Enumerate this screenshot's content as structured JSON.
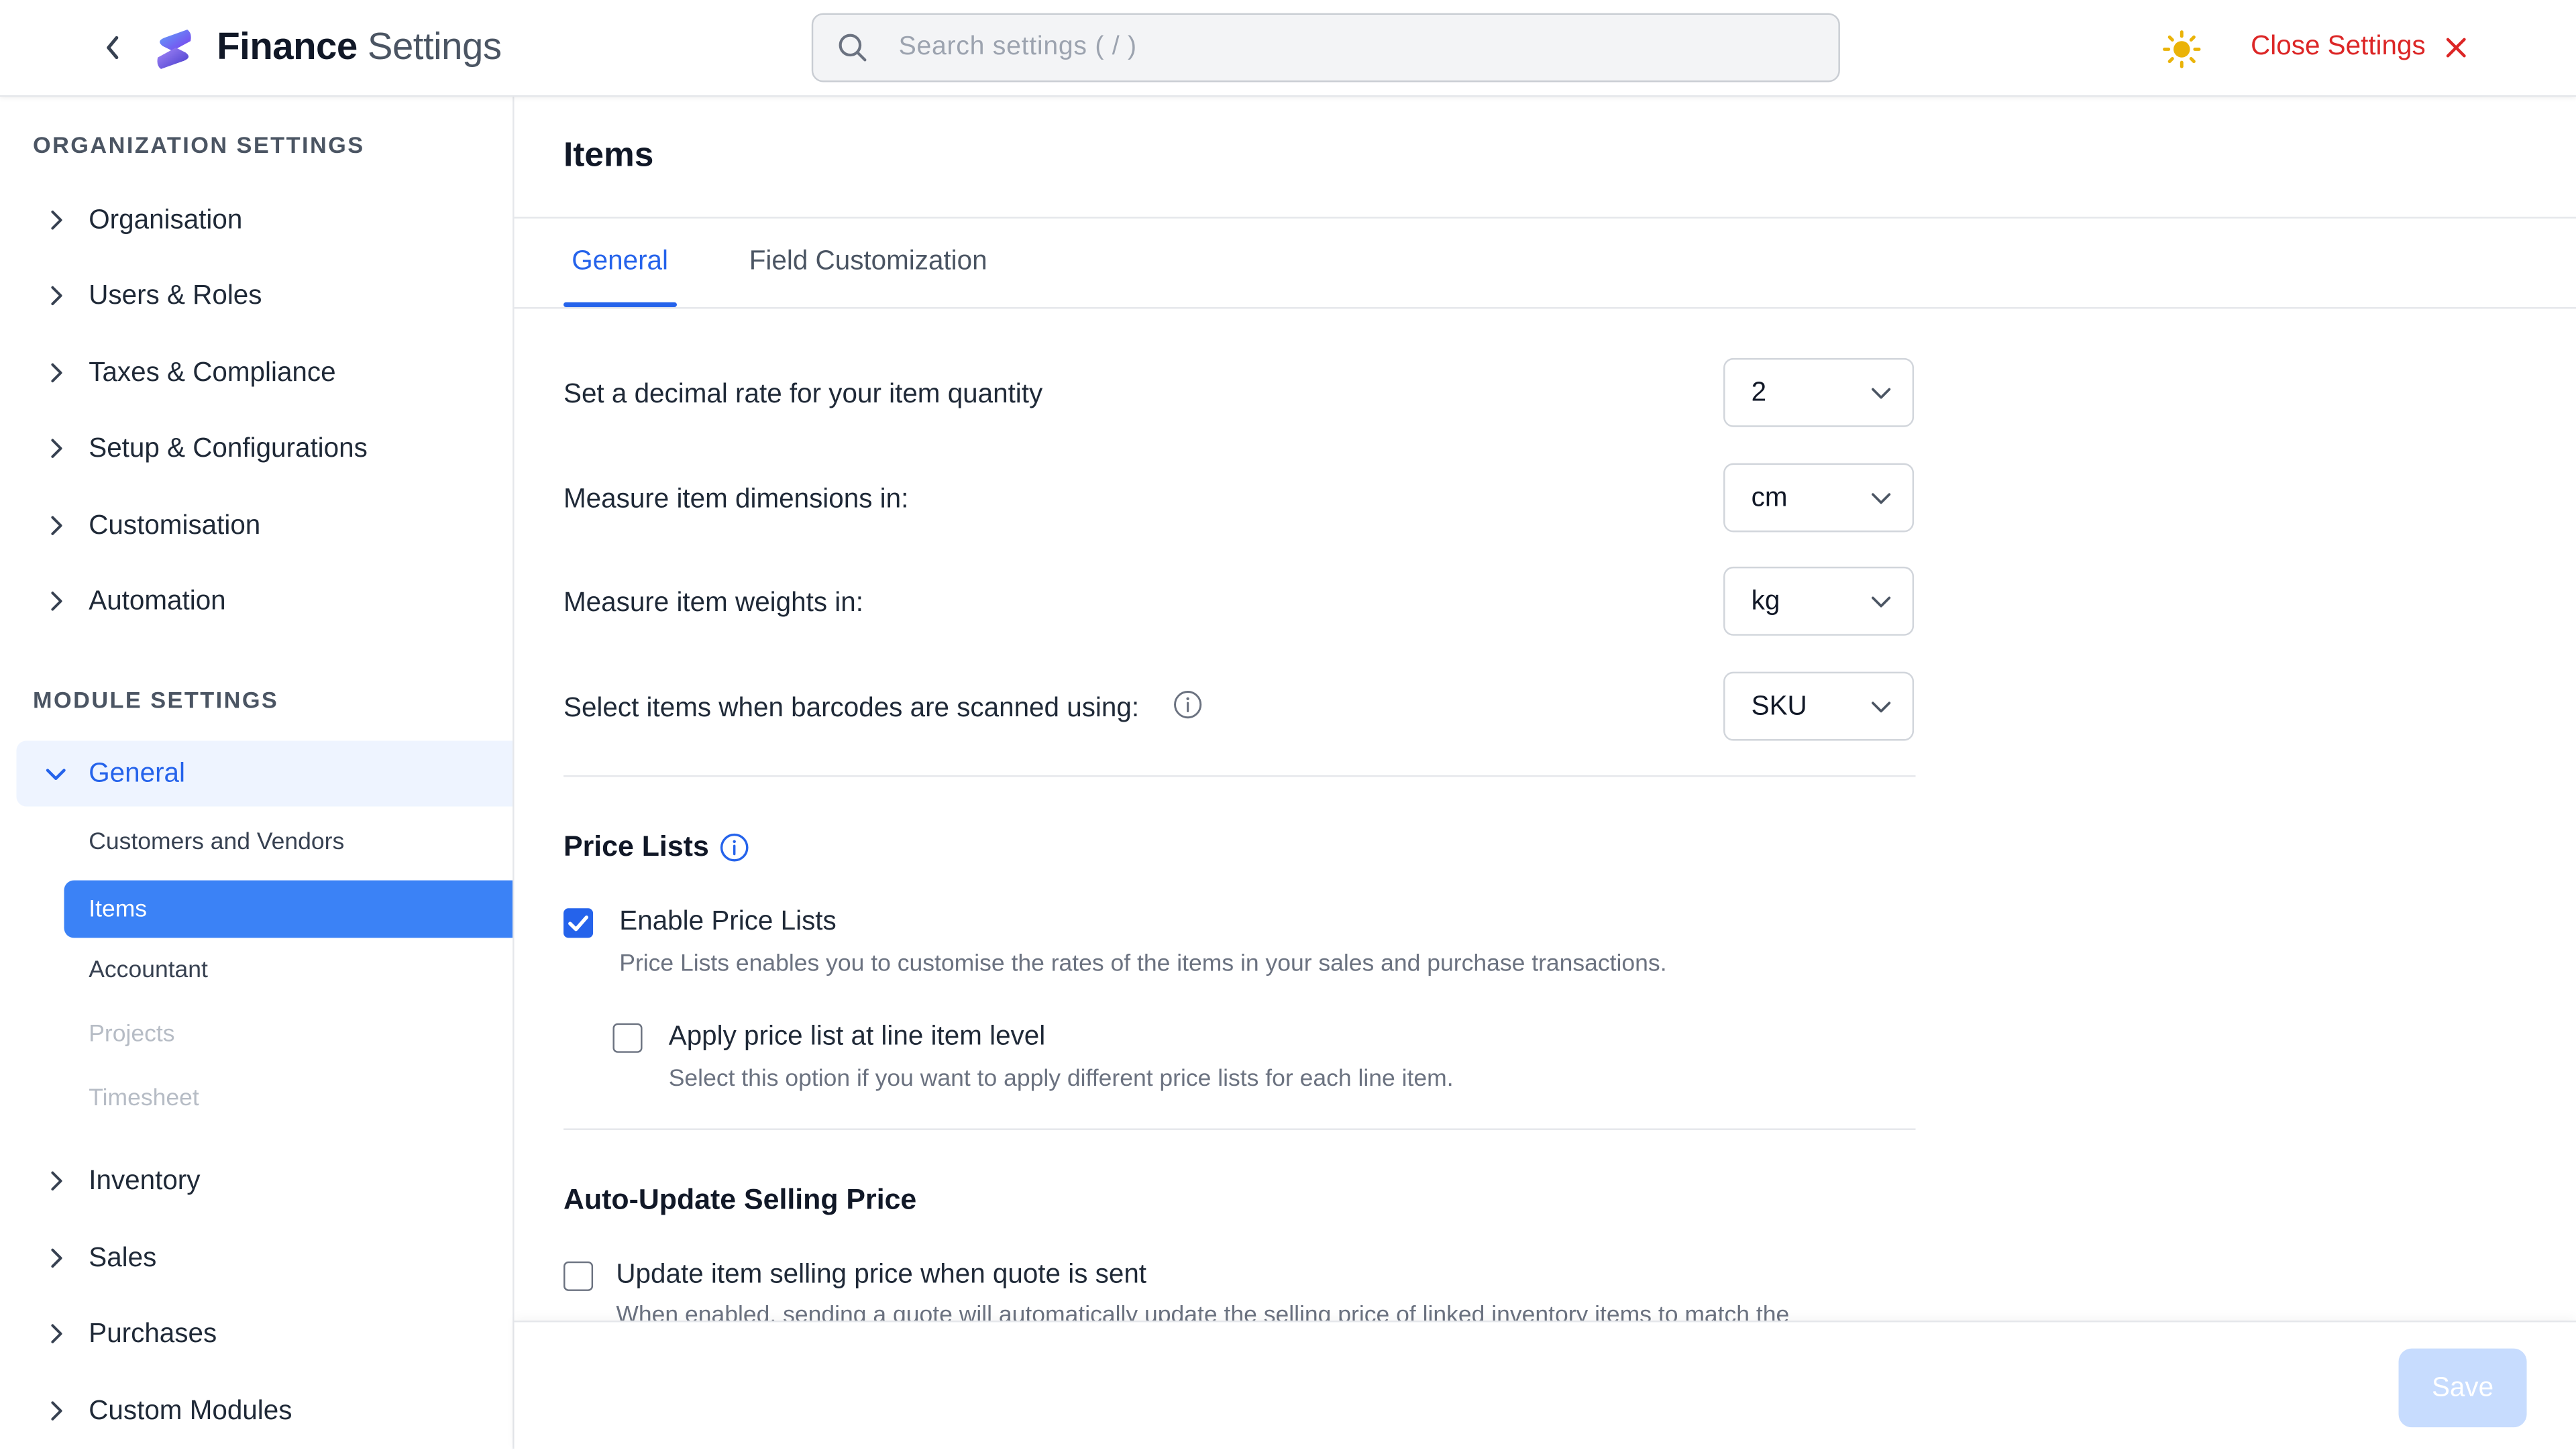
{
  "header": {
    "app_name": "Finance",
    "app_subtitle": "Settings",
    "search_placeholder": "Search settings ( / )",
    "close_label": "Close Settings",
    "theme_icon": "sun-icon",
    "accent_color": "#2563eb",
    "close_color": "#dc2626"
  },
  "sidebar": {
    "org_title": "ORGANIZATION SETTINGS",
    "org_items": [
      "Organisation",
      "Users & Roles",
      "Taxes & Compliance",
      "Setup & Configurations",
      "Customisation",
      "Automation"
    ],
    "module_title": "MODULE SETTINGS",
    "general_label": "General",
    "general_sub": [
      "Customers and Vendors",
      "Items",
      "Accountant",
      "Projects",
      "Timesheet"
    ],
    "module_items": [
      "Inventory",
      "Sales",
      "Purchases",
      "Custom Modules"
    ]
  },
  "main": {
    "title": "Items",
    "tabs": [
      "General",
      "Field Customization"
    ],
    "settings": [
      {
        "label": "Set a decimal rate for your item quantity",
        "value": "2"
      },
      {
        "label": "Measure item dimensions in:",
        "value": "cm"
      },
      {
        "label": "Measure item weights in:",
        "value": "kg"
      },
      {
        "label": "Select items when barcodes are scanned using:",
        "value": "SKU"
      }
    ],
    "price_lists": {
      "title": "Price Lists",
      "enable_label": "Enable Price Lists",
      "enable_checked": true,
      "enable_desc": "Price Lists enables you to customise the rates of the items in your sales and purchase transactions.",
      "line_label": "Apply price list at line item level",
      "line_checked": false,
      "line_desc": "Select this option if you want to apply different price lists for each line item."
    },
    "auto_update": {
      "title": "Auto-Update Selling Price",
      "label": "Update item selling price when quote is sent",
      "checked": false,
      "desc": "When enabled, sending a quote will automatically update the selling price of linked inventory items to match the"
    }
  },
  "footer": {
    "save_label": "Save"
  }
}
